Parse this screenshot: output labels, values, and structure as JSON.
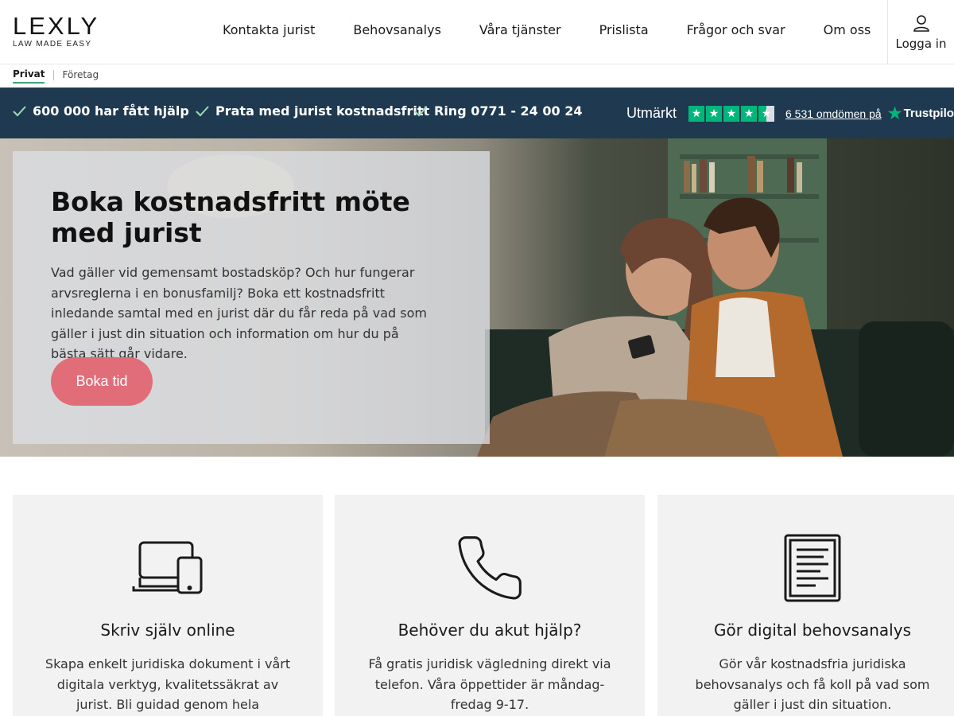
{
  "header": {
    "logo": "LEXLY",
    "logo_tagline": "LAW MADE EASY",
    "nav": [
      {
        "label": "Kontakta jurist"
      },
      {
        "label": "Behovsanalys"
      },
      {
        "label": "Våra tjänster"
      },
      {
        "label": "Prislista"
      },
      {
        "label": "Frågor och svar"
      },
      {
        "label": "Om oss"
      }
    ],
    "login_label": "Logga in"
  },
  "segments": {
    "active": "Privat",
    "inactive": "Företag"
  },
  "trustbar": {
    "usps": [
      "600 000 har fått hjälp",
      "Prata med jurist kostnadsfritt",
      "Ring 0771 - 24 00 24"
    ],
    "rating_label": "Utmärkt",
    "stars": 4.5,
    "reviews_label": "6 531 omdömen på",
    "provider": "Trustpilot",
    "star_color": "#00b67a"
  },
  "hero": {
    "title": "Boka kostnadsfritt möte med jurist",
    "text": "Vad gäller vid gemensamt bostadsköp? Och hur fungerar arvsreglerna i en bonusfamilj? Boka ett kostnadsfritt inledande samtal med en jurist där du får reda på vad som gäller i just din situation och information om hur du på bästa sätt går vidare.",
    "button": "Boka tid",
    "button_color": "#e06d78"
  },
  "cards": [
    {
      "icon": "laptop-tablet-icon",
      "title": "Skriv själv online",
      "text": "Skapa enkelt juridiska dokument i vårt digitala verktyg, kvalitetssäkrat av jurist. Bli guidad genom hela processen."
    },
    {
      "icon": "phone-icon",
      "title": "Behöver du akut hjälp?",
      "text": "Få gratis juridisk vägledning direkt via telefon. Våra öppettider är måndag-fredag 9-17."
    },
    {
      "icon": "document-icon",
      "title": "Gör digital behovsanalys",
      "text": "Gör vår kostnadsfria juridiska behovsanalys och få koll på vad som gäller i just din situation."
    }
  ],
  "colors": {
    "trustbar_bg": "#1f3a50",
    "accent_green": "#3aa876"
  }
}
